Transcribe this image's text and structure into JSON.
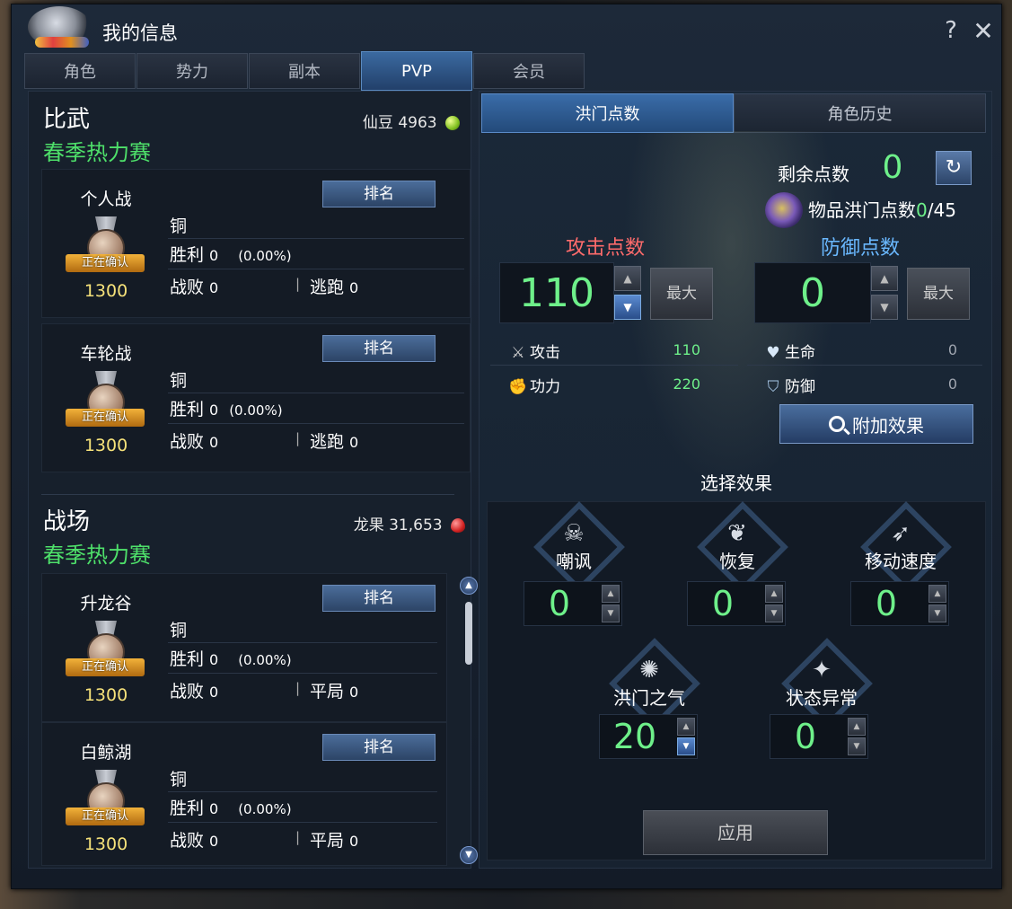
{
  "window": {
    "title": "我的信息",
    "help": "?",
    "close": "✕"
  },
  "tabs": [
    "角色",
    "势力",
    "副本",
    "PVP",
    "会员"
  ],
  "left": {
    "arena": {
      "title": "比武",
      "season": "春季热力赛",
      "currency_label": "仙豆",
      "currency_value": "4963",
      "cards": [
        {
          "name": "个人战",
          "rank_button": "排名",
          "badge": "正在确认",
          "score": "1300",
          "tier": "铜",
          "win_label": "胜利",
          "win_value": "0",
          "win_pct": "(0.00%)",
          "lose_label": "战败",
          "lose_value": "0",
          "extra_label": "逃跑",
          "extra_value": "0"
        },
        {
          "name": "车轮战",
          "rank_button": "排名",
          "badge": "正在确认",
          "score": "1300",
          "tier": "铜",
          "win_label": "胜利",
          "win_value": "0",
          "win_pct": "(0.00%)",
          "lose_label": "战败",
          "lose_value": "0",
          "extra_label": "逃跑",
          "extra_value": "0"
        }
      ]
    },
    "battlefield": {
      "title": "战场",
      "season": "春季热力赛",
      "currency_label": "龙果",
      "currency_value": "31,653",
      "cards": [
        {
          "name": "升龙谷",
          "rank_button": "排名",
          "badge": "正在确认",
          "score": "1300",
          "tier": "铜",
          "win_label": "胜利",
          "win_value": "0",
          "win_pct": "(0.00%)",
          "lose_label": "战败",
          "lose_value": "0",
          "extra_label": "平局",
          "extra_value": "0"
        },
        {
          "name": "白鲸湖",
          "rank_button": "排名",
          "badge": "正在确认",
          "score": "1300",
          "tier": "铜",
          "win_label": "胜利",
          "win_value": "0",
          "win_pct": "(0.00%)",
          "lose_label": "战败",
          "lose_value": "0",
          "extra_label": "平局",
          "extra_value": "0"
        }
      ]
    }
  },
  "right": {
    "tabs": [
      "洪门点数",
      "角色历史"
    ],
    "remaining_label": "剩余点数",
    "remaining_value": "0",
    "item_points_label": "物品洪门点数",
    "item_points_value": "0",
    "item_points_max": "/45",
    "attack_header": "攻击点数",
    "defense_header": "防御点数",
    "attack_points": "110",
    "defense_points": "0",
    "max_label": "最大",
    "stats": [
      {
        "icon": "swords-icon",
        "label": "攻击",
        "value": "110"
      },
      {
        "icon": "fist-icon",
        "label": "功力",
        "value": "220"
      },
      {
        "icon": "heart-icon",
        "label": "生命",
        "value": "0"
      },
      {
        "icon": "shield-icon",
        "label": "防御",
        "value": "0"
      }
    ],
    "extra_effect_button": "附加效果",
    "select_effect_title": "选择效果",
    "effects": [
      {
        "icon": "skull-icon",
        "label": "嘲讽",
        "value": "0"
      },
      {
        "icon": "sprout-icon",
        "label": "恢复",
        "value": "0"
      },
      {
        "icon": "runner-icon",
        "label": "移动速度",
        "value": "0"
      },
      {
        "icon": "dragon-icon",
        "label": "洪门之气",
        "value": "20"
      },
      {
        "icon": "stars-icon",
        "label": "状态异常",
        "value": "0"
      }
    ],
    "apply_button": "应用"
  },
  "colors": {
    "green": "#6ef08a",
    "season_green": "#4ee06a",
    "attack_red": "#ff6b6b",
    "defense_blue": "#6ab8ff",
    "score_yellow": "#f6e27a"
  }
}
